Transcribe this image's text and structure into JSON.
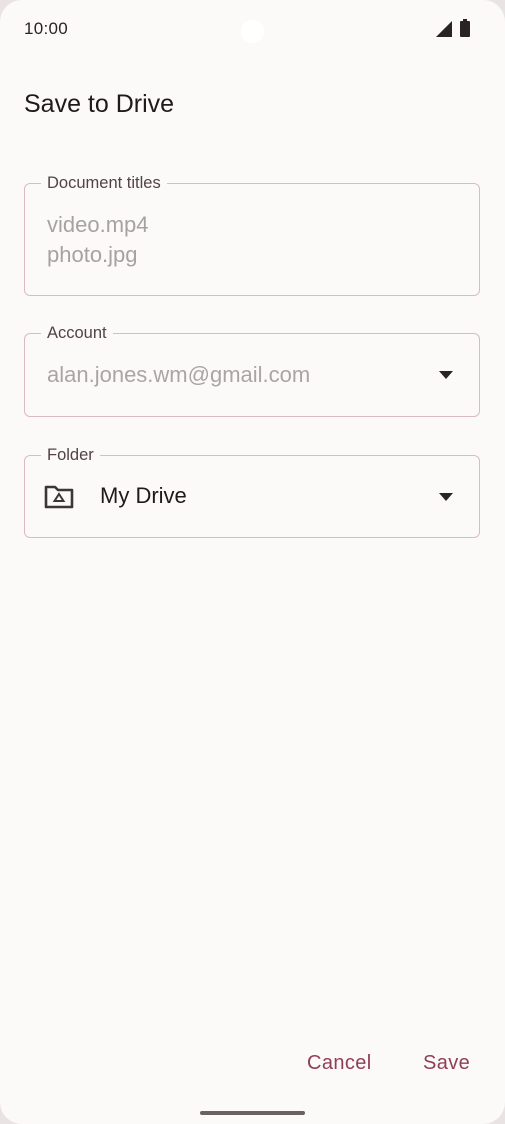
{
  "status_bar": {
    "time": "10:00",
    "icons": [
      "signal-icon",
      "battery-icon"
    ]
  },
  "dialog": {
    "title": "Save to Drive"
  },
  "fields": {
    "document_titles": {
      "label": "Document titles",
      "values": [
        "video.mp4",
        "photo.jpg"
      ]
    },
    "account": {
      "label": "Account",
      "value": "alan.jones.wm@gmail.com",
      "icon": "chevron-down-icon"
    },
    "folder": {
      "label": "Folder",
      "value": "My Drive",
      "icon": "drive-folder-icon",
      "dropdown_icon": "chevron-down-icon"
    }
  },
  "actions": {
    "cancel_label": "Cancel",
    "save_label": "Save"
  },
  "colors": {
    "accent": "#8f3f55",
    "outline": "#d9bcc1",
    "background": "#fcfaf9",
    "text_primary": "#201a1b",
    "text_disabled": "#a7a2a2"
  }
}
